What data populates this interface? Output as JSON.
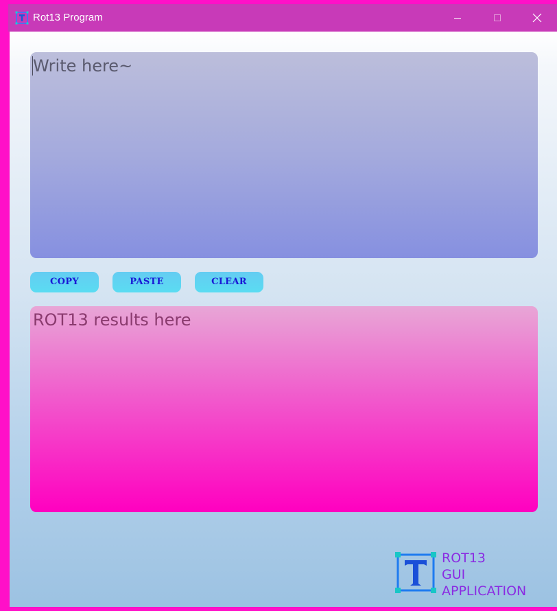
{
  "window": {
    "title": "Rot13 Program",
    "icon": "app-t-icon",
    "controls": [
      "minimize-icon",
      "maximize-icon",
      "close-icon"
    ]
  },
  "input": {
    "placeholder": "Write here~"
  },
  "buttons": {
    "copy": "COPY",
    "paste": "PASTE",
    "clear": "CLEAR"
  },
  "output": {
    "placeholder": "ROT13 results here"
  },
  "branding": {
    "line1": "ROT13",
    "line2": "GUI",
    "line3": "APPLICATION",
    "logo_letter": "T"
  },
  "colors": {
    "titlebar": "#c83ab8",
    "border": "#ff10c8",
    "button_text": "#1818d6",
    "brand_text": "#8a2be2"
  }
}
